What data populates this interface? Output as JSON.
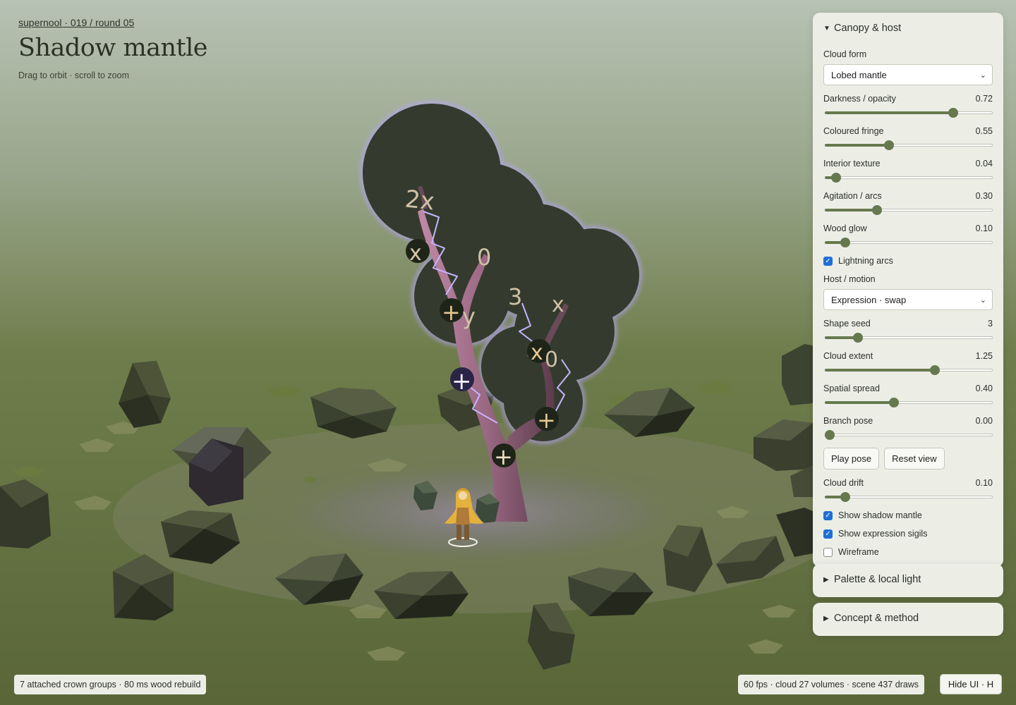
{
  "header": {
    "breadcrumb": "supernool · 019 / round 05",
    "title": "Shadow mantle",
    "hint": "Drag to orbit · scroll to zoom"
  },
  "scene": {
    "sigils": [
      "2x",
      "x",
      "0",
      "+",
      "y",
      "3",
      "x",
      "x",
      "0",
      "+",
      "+",
      "+"
    ],
    "colors": {
      "sky_top": "#b8c2b4",
      "ground": "#5f6b3c",
      "canopy": "#343b2e",
      "trunk": "#6e4a5c",
      "arc": "#b9a2ff",
      "cloak": "#e4b23c"
    }
  },
  "panel": {
    "canopy": {
      "title": "Canopy & host",
      "cloud_form_label": "Cloud form",
      "cloud_form_value": "Lobed mantle",
      "sliders_a": [
        {
          "label": "Darkness / opacity",
          "value": "0.72",
          "level": 0.79
        },
        {
          "label": "Coloured fringe",
          "value": "0.55",
          "level": 0.38
        },
        {
          "label": "Interior texture",
          "value": "0.04",
          "level": 0.04
        },
        {
          "label": "Agitation / arcs",
          "value": "0.30",
          "level": 0.3
        },
        {
          "label": "Wood glow",
          "value": "0.10",
          "level": 0.1
        }
      ],
      "lightning_label": "Lightning arcs",
      "host_motion_label": "Host / motion",
      "host_motion_value": "Expression · swap",
      "sliders_b": [
        {
          "label": "Shape seed",
          "value": "3",
          "level": 0.18
        },
        {
          "label": "Cloud extent",
          "value": "1.25",
          "level": 0.67
        },
        {
          "label": "Spatial spread",
          "value": "0.40",
          "level": 0.41
        },
        {
          "label": "Branch pose",
          "value": "0.00",
          "level": 0.0
        }
      ],
      "play_pose": "Play pose",
      "reset_view": "Reset view",
      "cloud_drift": {
        "label": "Cloud drift",
        "value": "0.10",
        "level": 0.1
      },
      "checks": [
        {
          "label": "Show shadow mantle",
          "checked": true
        },
        {
          "label": "Show expression sigils",
          "checked": true
        },
        {
          "label": "Wireframe",
          "checked": false
        }
      ]
    },
    "palette_title": "Palette & local light",
    "concept_title": "Concept & method"
  },
  "footer": {
    "left": "7 attached crown groups · 80 ms wood rebuild",
    "right": "60 fps · cloud 27 volumes · scene 437 draws",
    "hide_ui": "Hide UI · H"
  }
}
